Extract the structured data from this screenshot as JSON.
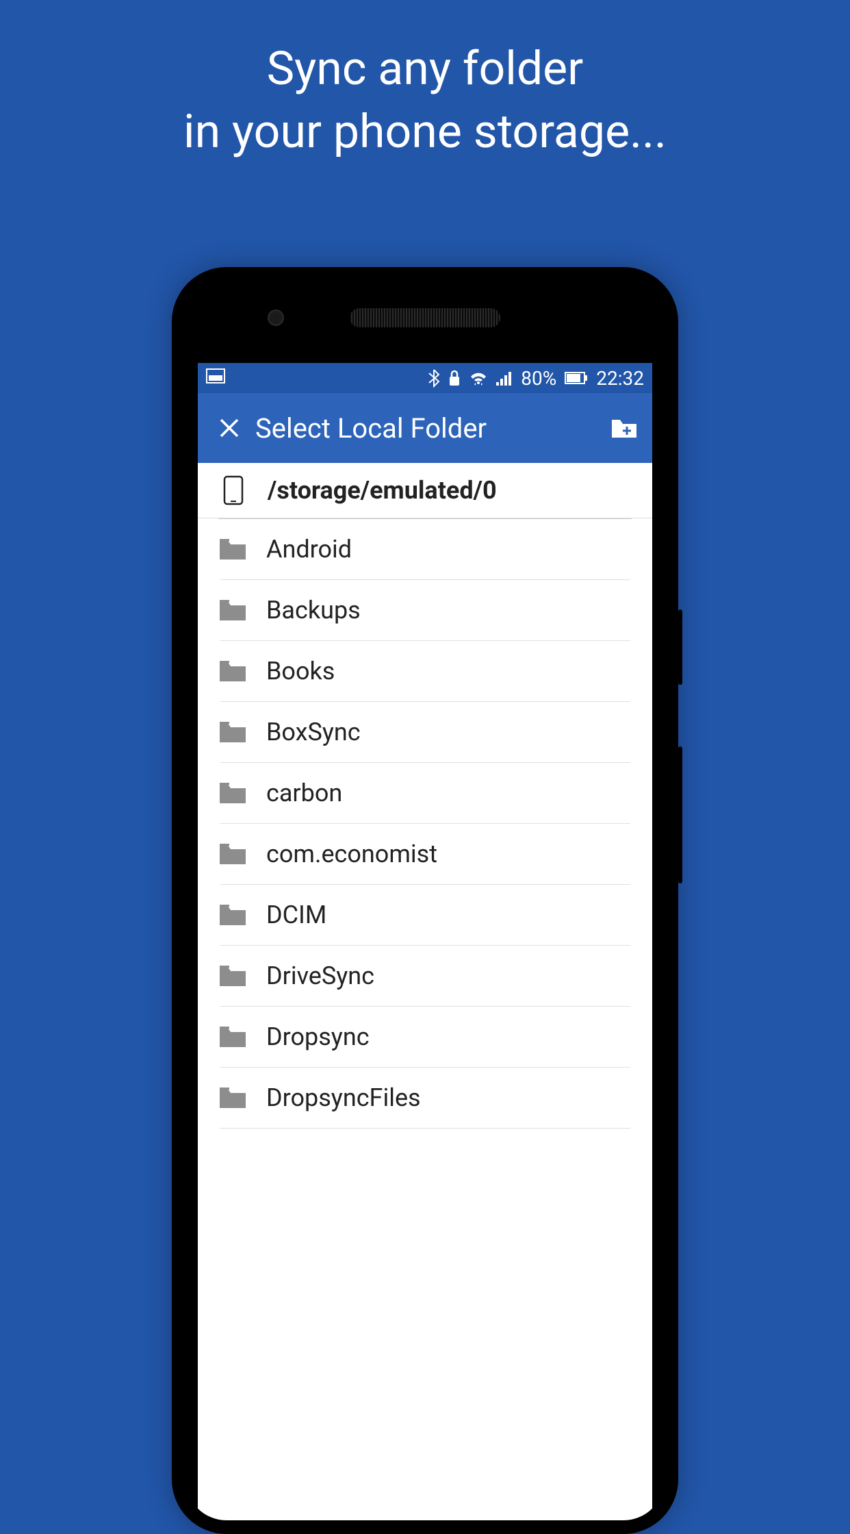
{
  "promo": {
    "line1": "Sync any folder",
    "line2": "in your phone storage..."
  },
  "statusBar": {
    "battery": "80%",
    "time": "22:32"
  },
  "appBar": {
    "title": "Select Local Folder"
  },
  "currentPath": "/storage/emulated/0",
  "folders": [
    {
      "name": "Android"
    },
    {
      "name": "Backups"
    },
    {
      "name": "Books"
    },
    {
      "name": "BoxSync"
    },
    {
      "name": "carbon"
    },
    {
      "name": "com.economist"
    },
    {
      "name": "DCIM"
    },
    {
      "name": "DriveSync"
    },
    {
      "name": "Dropsync"
    },
    {
      "name": "DropsyncFiles"
    }
  ]
}
